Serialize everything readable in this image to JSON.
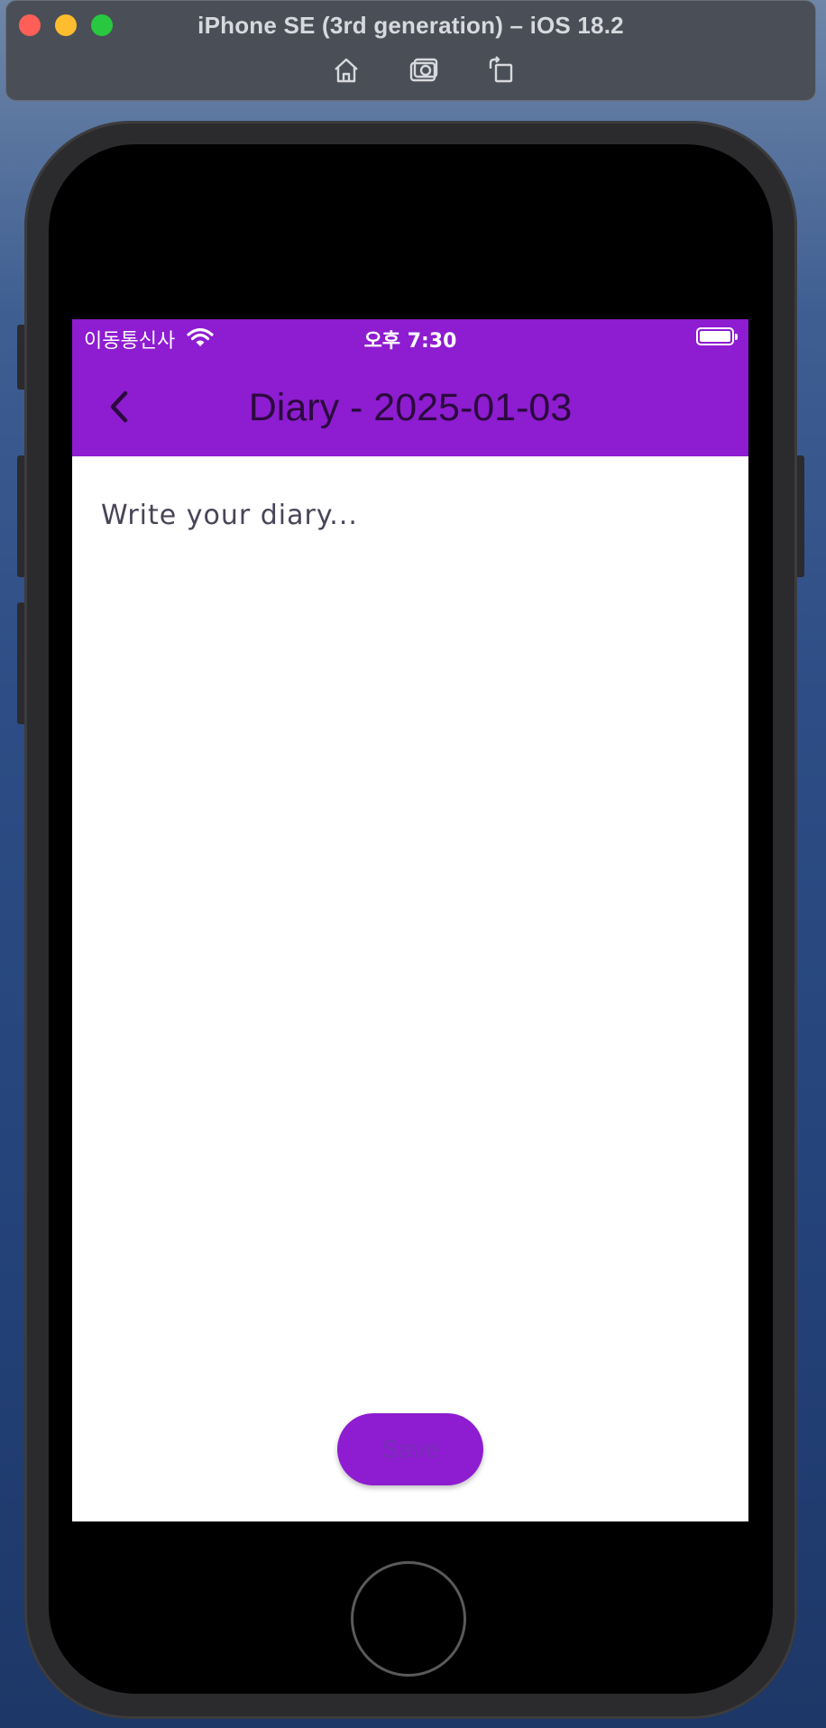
{
  "simulator": {
    "title": "iPhone SE (3rd generation) – iOS 18.2",
    "toolbar": [
      {
        "name": "home-icon",
        "tooltip": ""
      },
      {
        "name": "screenshot-icon",
        "tooltip": ""
      },
      {
        "name": "rotate-icon",
        "tooltip": ""
      }
    ]
  },
  "status_bar": {
    "carrier": "이동통신사",
    "time": "오후 7:30"
  },
  "app_bar": {
    "title": "Diary - 2025-01-03",
    "back_icon": "chevron-left-icon"
  },
  "editor": {
    "placeholder": "Write your diary...",
    "value": ""
  },
  "actions": {
    "save_label": "Save"
  },
  "colors": {
    "accent": "#8e1cd0",
    "title_text": "#2b0a3d"
  }
}
